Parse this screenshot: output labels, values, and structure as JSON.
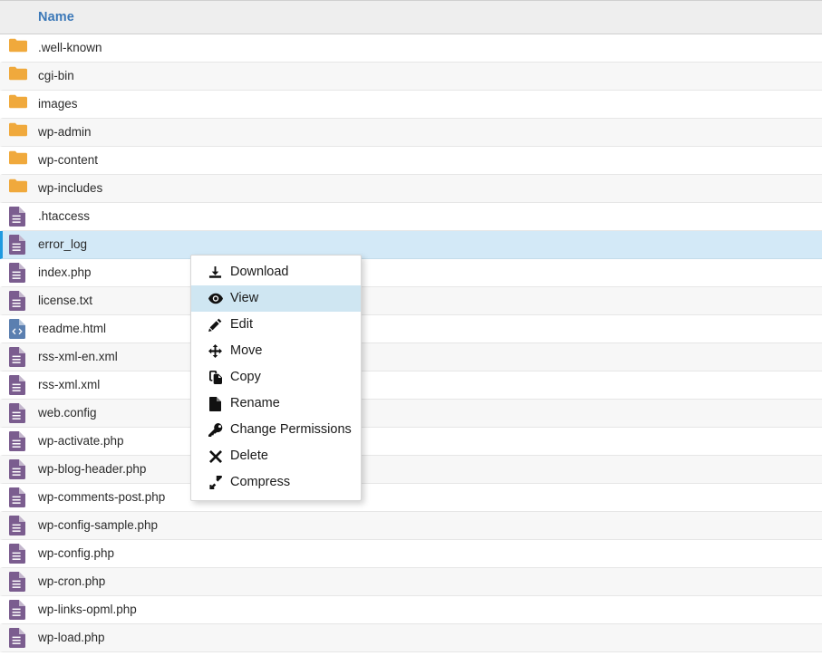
{
  "table": {
    "columns": [
      {
        "key": "name",
        "label": "Name"
      }
    ],
    "rows": [
      {
        "name": ".well-known",
        "kind": "folder",
        "icon": "folder-icon",
        "selected": false
      },
      {
        "name": "cgi-bin",
        "kind": "folder",
        "icon": "folder-icon",
        "selected": false
      },
      {
        "name": "images",
        "kind": "folder",
        "icon": "folder-icon",
        "selected": false
      },
      {
        "name": "wp-admin",
        "kind": "folder",
        "icon": "folder-icon",
        "selected": false
      },
      {
        "name": "wp-content",
        "kind": "folder",
        "icon": "folder-icon",
        "selected": false
      },
      {
        "name": "wp-includes",
        "kind": "folder",
        "icon": "folder-icon",
        "selected": false
      },
      {
        "name": ".htaccess",
        "kind": "file",
        "icon": "text-file-icon",
        "selected": false
      },
      {
        "name": "error_log",
        "kind": "file",
        "icon": "text-file-icon",
        "selected": true
      },
      {
        "name": "index.php",
        "kind": "file",
        "icon": "text-file-icon",
        "selected": false
      },
      {
        "name": "license.txt",
        "kind": "file",
        "icon": "text-file-icon",
        "selected": false
      },
      {
        "name": "readme.html",
        "kind": "file",
        "icon": "code-file-icon",
        "selected": false
      },
      {
        "name": "rss-xml-en.xml",
        "kind": "file",
        "icon": "text-file-icon",
        "selected": false
      },
      {
        "name": "rss-xml.xml",
        "kind": "file",
        "icon": "text-file-icon",
        "selected": false
      },
      {
        "name": "web.config",
        "kind": "file",
        "icon": "text-file-icon",
        "selected": false
      },
      {
        "name": "wp-activate.php",
        "kind": "file",
        "icon": "text-file-icon",
        "selected": false
      },
      {
        "name": "wp-blog-header.php",
        "kind": "file",
        "icon": "text-file-icon",
        "selected": false
      },
      {
        "name": "wp-comments-post.php",
        "kind": "file",
        "icon": "text-file-icon",
        "selected": false
      },
      {
        "name": "wp-config-sample.php",
        "kind": "file",
        "icon": "text-file-icon",
        "selected": false
      },
      {
        "name": "wp-config.php",
        "kind": "file",
        "icon": "text-file-icon",
        "selected": false
      },
      {
        "name": "wp-cron.php",
        "kind": "file",
        "icon": "text-file-icon",
        "selected": false
      },
      {
        "name": "wp-links-opml.php",
        "kind": "file",
        "icon": "text-file-icon",
        "selected": false
      },
      {
        "name": "wp-load.php",
        "kind": "file",
        "icon": "text-file-icon",
        "selected": false
      }
    ]
  },
  "context_menu": {
    "items": [
      {
        "label": "Download",
        "icon": "download-icon",
        "highlighted": false
      },
      {
        "label": "View",
        "icon": "eye-icon",
        "highlighted": true
      },
      {
        "label": "Edit",
        "icon": "pencil-icon",
        "highlighted": false
      },
      {
        "label": "Move",
        "icon": "move-arrows-icon",
        "highlighted": false
      },
      {
        "label": "Copy",
        "icon": "copy-icon",
        "highlighted": false
      },
      {
        "label": "Rename",
        "icon": "file-icon",
        "highlighted": false
      },
      {
        "label": "Change Permissions",
        "icon": "key-icon",
        "highlighted": false
      },
      {
        "label": "Delete",
        "icon": "x-mark-icon",
        "highlighted": false
      },
      {
        "label": "Compress",
        "icon": "compress-icon",
        "highlighted": false
      }
    ]
  },
  "colors": {
    "header_background": "#eeeeee",
    "header_text": "#3b78b8",
    "row_alt_background": "#f7f7f7",
    "row_selected_background": "#d3e9f7",
    "row_selected_accent": "#1e9ae0",
    "folder_icon": "#f0a93c",
    "file_icon": "#7b5d8f",
    "code_file_icon": "#5b7fb0",
    "menu_highlight_background": "#cfe6f2"
  }
}
